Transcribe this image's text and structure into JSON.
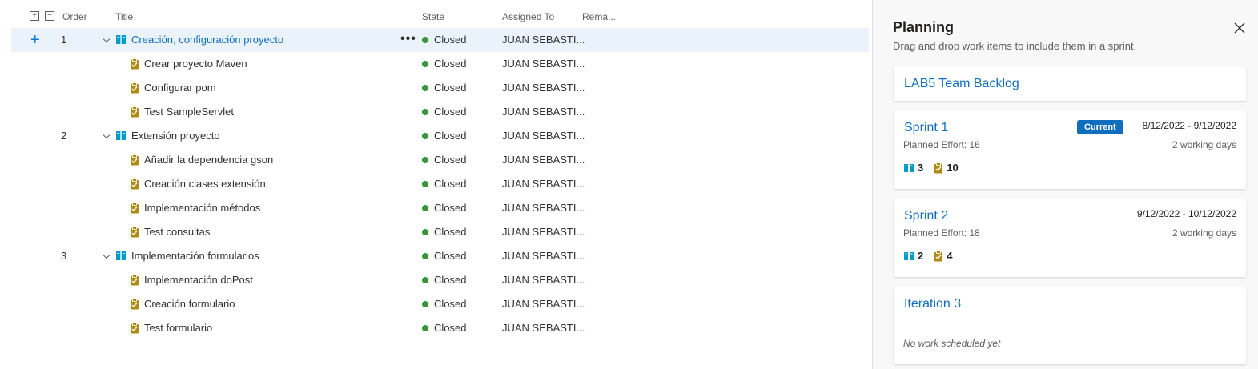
{
  "grid": {
    "headers": {
      "order": "Order",
      "title": "Title",
      "state": "State",
      "assigned": "Assigned To",
      "remaining": "Rema..."
    },
    "expand_all": "+",
    "collapse_all": "−",
    "add_symbol": "+",
    "more_symbol": "•••",
    "rows": [
      {
        "type": "story",
        "order": "1",
        "title": "Creación, configuración proyecto",
        "state": "Closed",
        "assigned": "JUAN SEBASTI..."
      },
      {
        "type": "task",
        "title": "Crear proyecto Maven",
        "state": "Closed",
        "assigned": "JUAN SEBASTI..."
      },
      {
        "type": "task",
        "title": "Configurar pom",
        "state": "Closed",
        "assigned": "JUAN SEBASTI..."
      },
      {
        "type": "task",
        "title": "Test SampleServlet",
        "state": "Closed",
        "assigned": "JUAN SEBASTI..."
      },
      {
        "type": "story",
        "order": "2",
        "title": "Extensión proyecto",
        "state": "Closed",
        "assigned": "JUAN SEBASTI..."
      },
      {
        "type": "task",
        "title": "Añadir la dependencia gson",
        "state": "Closed",
        "assigned": "JUAN SEBASTI..."
      },
      {
        "type": "task",
        "title": "Creación clases extensión",
        "state": "Closed",
        "assigned": "JUAN SEBASTI..."
      },
      {
        "type": "task",
        "title": "Implementación métodos",
        "state": "Closed",
        "assigned": "JUAN SEBASTI..."
      },
      {
        "type": "task",
        "title": "Test consultas",
        "state": "Closed",
        "assigned": "JUAN SEBASTI..."
      },
      {
        "type": "story",
        "order": "3",
        "title": "Implementación formularios",
        "state": "Closed",
        "assigned": "JUAN SEBASTI..."
      },
      {
        "type": "task",
        "title": "Implementación doPost",
        "state": "Closed",
        "assigned": "JUAN SEBASTI..."
      },
      {
        "type": "task",
        "title": "Creación formulario",
        "state": "Closed",
        "assigned": "JUAN SEBASTI..."
      },
      {
        "type": "task",
        "title": "Test formulario",
        "state": "Closed",
        "assigned": "JUAN SEBASTI..."
      }
    ]
  },
  "planning": {
    "title": "Planning",
    "subtitle": "Drag and drop work items to include them in a sprint.",
    "backlog": "LAB5 Team Backlog",
    "sprints": [
      {
        "name": "Sprint 1",
        "badge": "Current",
        "dates": "8/12/2022 - 9/12/2022",
        "effort": "Planned Effort: 16",
        "working_days": "2 working days",
        "stories": "3",
        "tasks": "10"
      },
      {
        "name": "Sprint 2",
        "dates": "9/12/2022 - 10/12/2022",
        "effort": "Planned Effort: 18",
        "working_days": "2 working days",
        "stories": "2",
        "tasks": "4"
      }
    ],
    "iteration": {
      "name": "Iteration 3",
      "empty": "No work scheduled yet"
    }
  },
  "colors": {
    "accent": "#106ebe",
    "closed": "#339933",
    "task": "#b08a12",
    "story": "#009ccc",
    "selected": "#eaf3fb"
  },
  "icons": {
    "story": "book-icon",
    "task": "clipboard-icon",
    "close": "close-icon",
    "chevron": "chevron-down-icon"
  }
}
